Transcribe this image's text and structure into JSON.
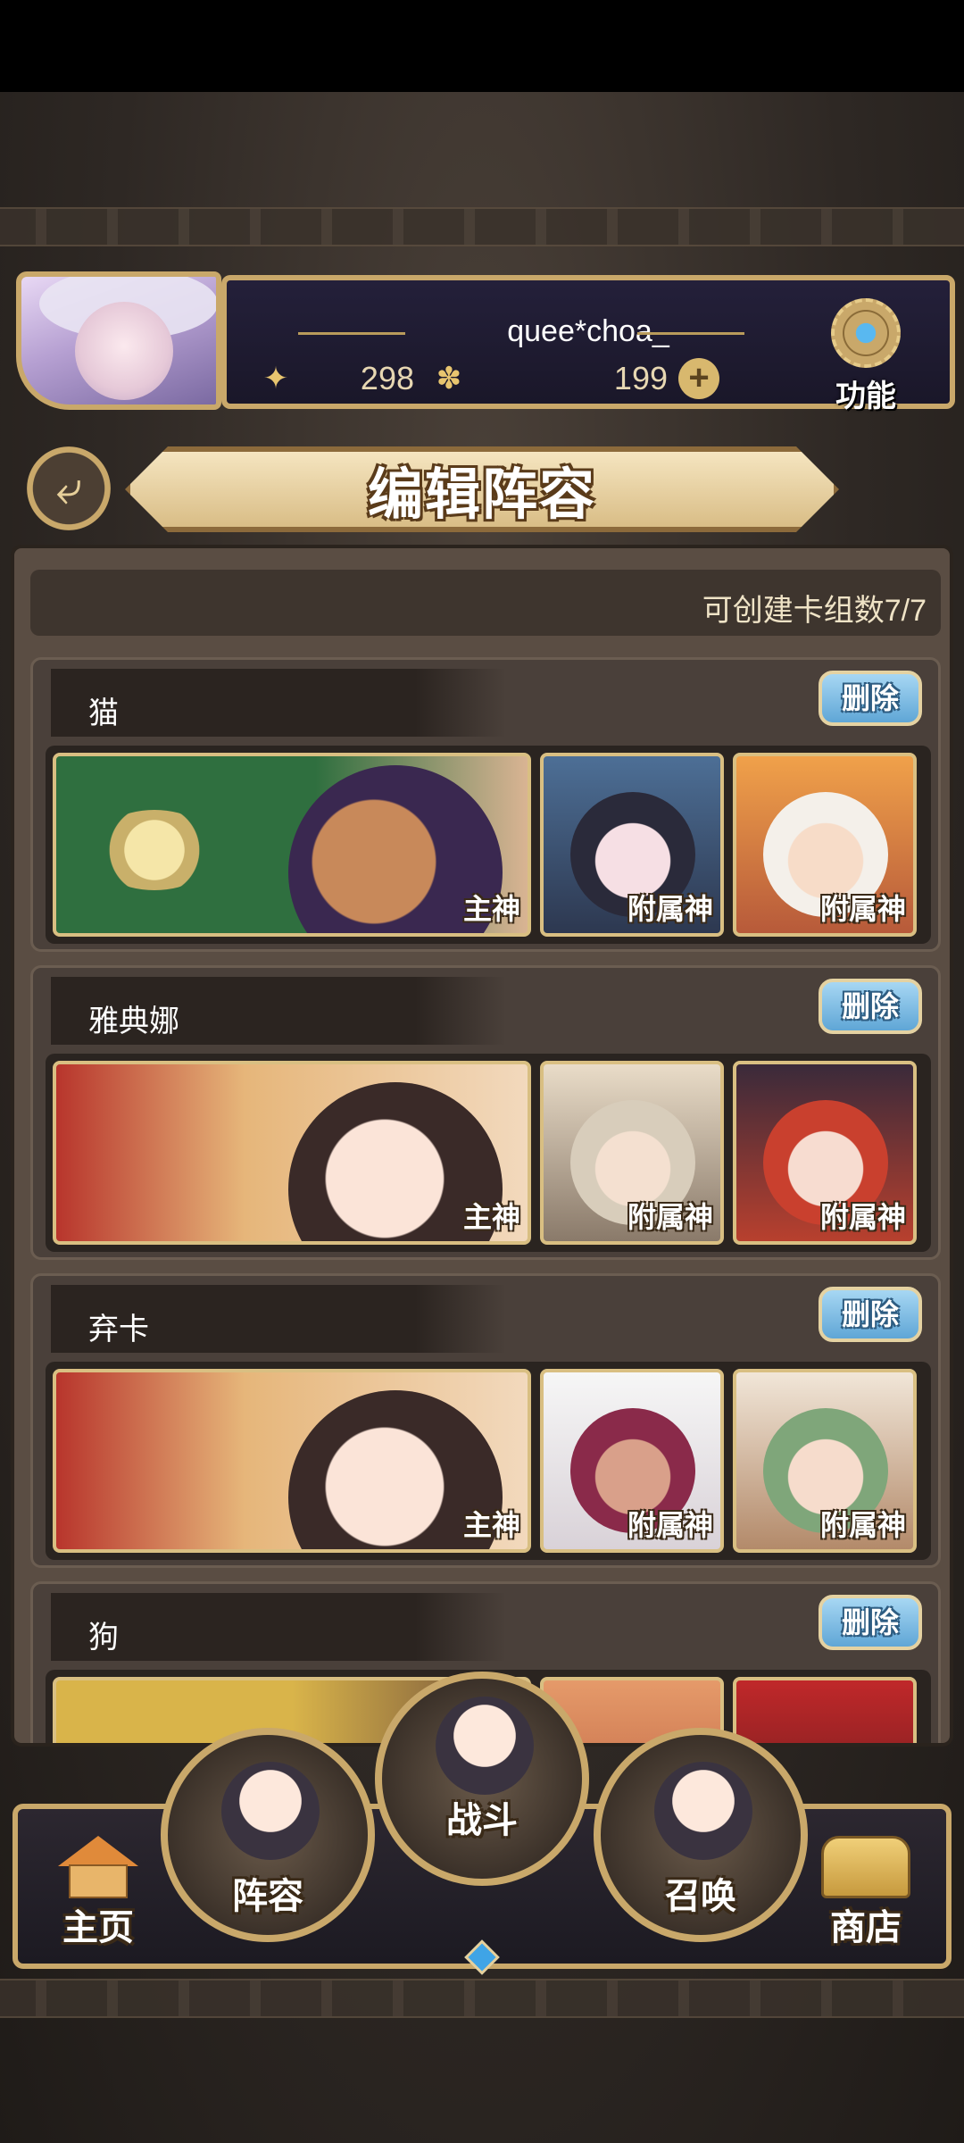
{
  "header": {
    "username": "quee*choa_",
    "resource_1": "298",
    "resource_2": "199",
    "function_label": "功能"
  },
  "page": {
    "title": "编辑阵容",
    "deck_count_text": "可创建卡组数7/7"
  },
  "decks": [
    {
      "name": "猫",
      "delete_label": "删除",
      "main_label": "主神",
      "sub1_label": "附属神",
      "sub2_label": "附属神"
    },
    {
      "name": "雅典娜",
      "delete_label": "删除",
      "main_label": "主神",
      "sub1_label": "附属神",
      "sub2_label": "附属神"
    },
    {
      "name": "弃卡",
      "delete_label": "删除",
      "main_label": "主神",
      "sub1_label": "附属神",
      "sub2_label": "附属神"
    },
    {
      "name": "狗",
      "delete_label": "删除"
    }
  ],
  "nav": {
    "home": "主页",
    "lineup": "阵容",
    "battle": "战斗",
    "summon": "召唤",
    "shop": "商店"
  },
  "colors": {
    "gold_frame": "#c9a86a",
    "delete_blue": "#5fa6d6",
    "panel_brown": "#5a4d43"
  }
}
